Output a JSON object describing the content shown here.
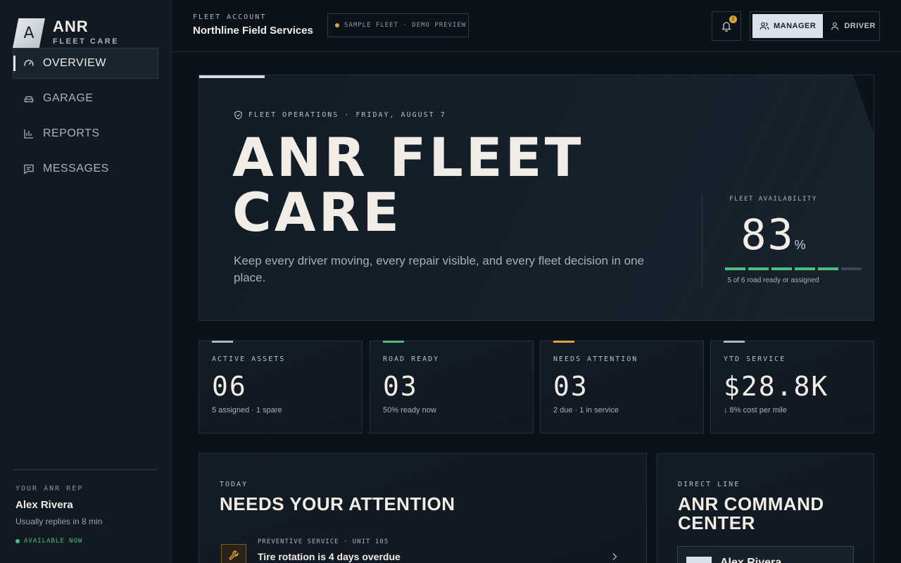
{
  "brand": {
    "mark": "A",
    "name": "ANR",
    "sub": "FLEET CARE"
  },
  "nav": [
    {
      "label": "OVERVIEW",
      "icon": "gauge-icon",
      "active": true
    },
    {
      "label": "GARAGE",
      "icon": "car-icon",
      "active": false
    },
    {
      "label": "REPORTS",
      "icon": "bar-chart-icon",
      "active": false
    },
    {
      "label": "MESSAGES",
      "icon": "message-icon",
      "active": false
    }
  ],
  "rep": {
    "label": "YOUR ANR REP",
    "name": "Alex Rivera",
    "note": "Usually replies in 8 min",
    "status": "AVAILABLE NOW"
  },
  "topbar": {
    "account_label": "FLEET ACCOUNT",
    "account_name": "Northline Field Services",
    "sample_badge": "SAMPLE FLEET · DEMO PREVIEW",
    "notification_count": "2",
    "roles": {
      "manager": "MANAGER",
      "driver": "DRIVER"
    },
    "active_role": "manager"
  },
  "hero": {
    "eyebrow": "FLEET OPERATIONS · FRIDAY, AUGUST 7",
    "title_line1": "ANR FLEET",
    "title_line2": "CARE",
    "description": "Keep every driver moving, every repair visible, and every fleet decision in one place.",
    "availability": {
      "label": "FLEET AVAILABILITY",
      "value": "83",
      "unit": "%",
      "ready": 5,
      "total": 6,
      "note": "5 of 6 road ready or assigned"
    }
  },
  "stats": [
    {
      "label": "ACTIVE ASSETS",
      "value": "06",
      "sub": "5 assigned · 1 spare",
      "accent": "#aeb8c3"
    },
    {
      "label": "ROAD READY",
      "value": "03",
      "sub": "50% ready now",
      "accent": "#4dbd82"
    },
    {
      "label": "NEEDS ATTENTION",
      "value": "03",
      "sub": "2 due · 1 in service",
      "accent": "#e0a23a"
    },
    {
      "label": "YTD SERVICE",
      "value": "$28.8K",
      "sub": "↓ 8% cost per mile",
      "accent": "#aeb8c3"
    }
  ],
  "attention": {
    "label": "TODAY",
    "title": "NEEDS YOUR ATTENTION",
    "items": [
      {
        "meta": "PREVENTIVE SERVICE · UNIT 105",
        "title": "Tire rotation is 4 days overdue",
        "icon": "wrench-icon"
      }
    ]
  },
  "command": {
    "label": "DIRECT LINE",
    "title_line1": "ANR COMMAND",
    "title_line2": "CENTER",
    "contact_name": "Alex Rivera"
  },
  "colors": {
    "accent_green": "#4dbd82",
    "accent_amber": "#e0a23a",
    "background": "#0c1219"
  }
}
